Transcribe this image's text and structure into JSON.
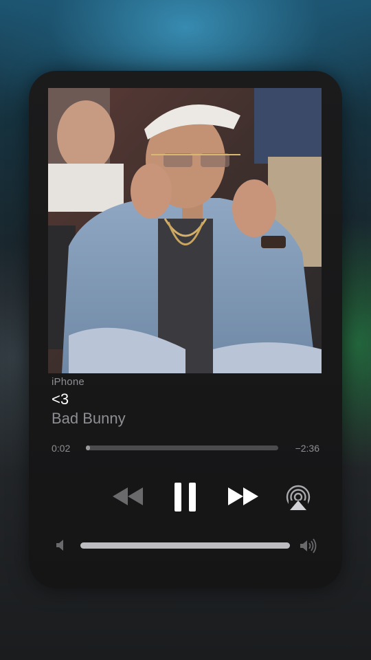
{
  "now_playing": {
    "source": "iPhone",
    "title": "<3",
    "artist": "Bad Bunny",
    "elapsed": "0:02",
    "remaining": "−2:36",
    "progress_fraction": 0.007,
    "volume_fraction": 1.0
  },
  "controls": {
    "rewind_icon": "rewind-icon",
    "pause_icon": "pause-icon",
    "forward_icon": "fast-forward-icon",
    "airplay_icon": "airplay-icon",
    "volume_low_icon": "speaker-low-icon",
    "volume_high_icon": "speaker-high-icon"
  },
  "colors": {
    "card_background": "#1b1b1c",
    "primary_text": "#ffffff",
    "secondary_text": "#8e8e93",
    "track": "#4b4b4e",
    "volume_fill": "#bdbdc1",
    "disabled_icon": "#6a6a6d"
  }
}
